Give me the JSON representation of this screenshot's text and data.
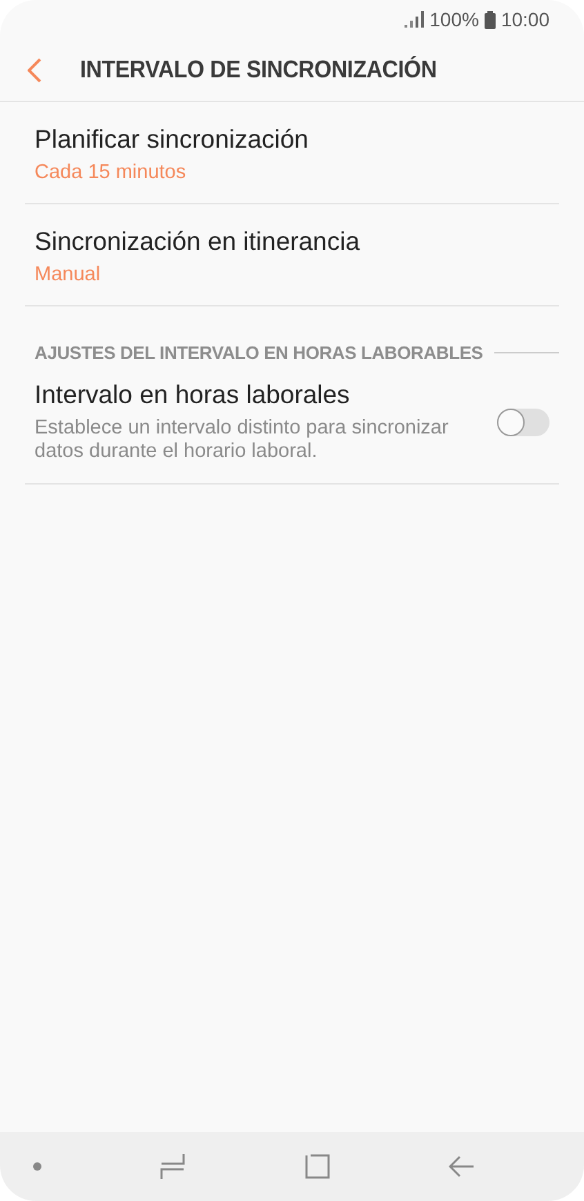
{
  "status_bar": {
    "battery": "100%",
    "time": "10:00"
  },
  "header": {
    "title": "INTERVALO DE SINCRONIZACIÓN"
  },
  "items": [
    {
      "title": "Planificar sincronización",
      "value": "Cada 15 minutos"
    },
    {
      "title": "Sincronización en itinerancia",
      "value": "Manual"
    }
  ],
  "section": {
    "title": "AJUSTES DEL INTERVALO EN HORAS LABORABLES",
    "items": [
      {
        "title": "Intervalo en horas laborales",
        "description": "Establece un intervalo distinto para sincronizar datos durante el horario laboral.",
        "on": false
      }
    ]
  }
}
